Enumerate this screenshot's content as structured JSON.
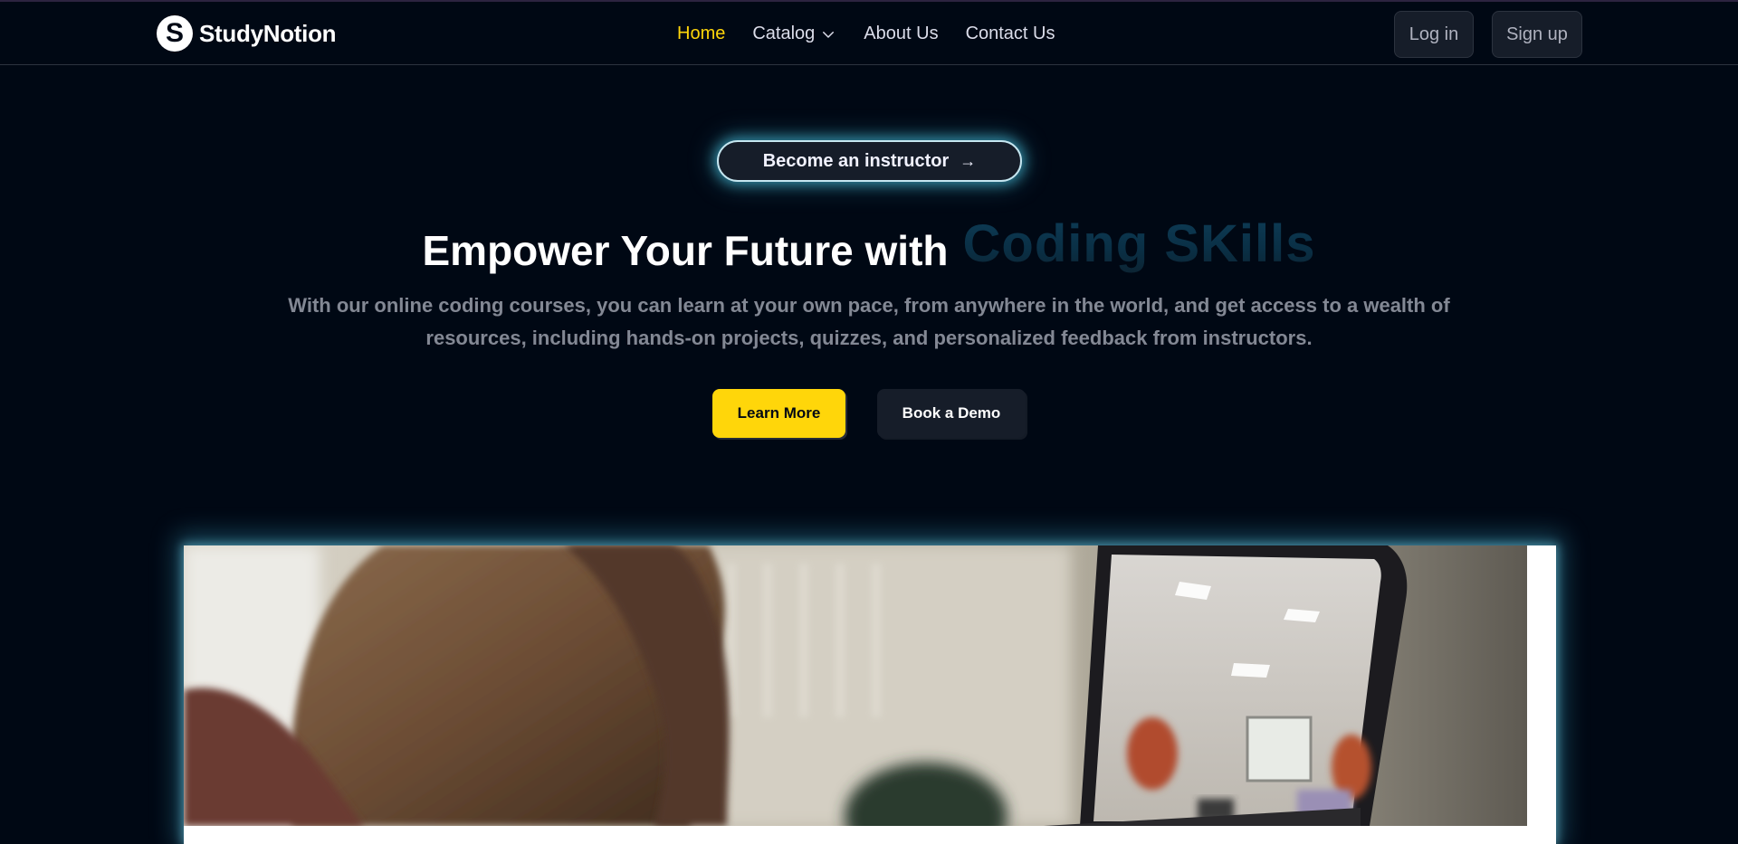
{
  "brand": {
    "logo_letter": "S",
    "name": "StudyNotion"
  },
  "nav": {
    "items": [
      {
        "label": "Home",
        "active": true
      },
      {
        "label": "Catalog",
        "has_dropdown": true
      },
      {
        "label": "About Us"
      },
      {
        "label": "Contact Us"
      }
    ]
  },
  "auth": {
    "login_label": "Log in",
    "signup_label": "Sign up"
  },
  "hero": {
    "instructor_label": "Become an instructor",
    "arrow": "→",
    "headline": "Empower Your Future with",
    "headline_accent": "Coding SKills",
    "subtitle": "With our online coding courses, you can learn at your own pace, from anywhere in the world, and get access to a wealth of resources, including hands-on projects, quizzes, and personalized feedback from instructors.",
    "cta_primary": "Learn More",
    "cta_secondary": "Book a Demo"
  },
  "colors": {
    "background": "#000814",
    "accent_yellow": "#ffd60a",
    "glow_blue": "#46bedc",
    "button_dark": "#161d29"
  },
  "icons": [
    "chevron-down-icon",
    "arrow-right-icon"
  ]
}
